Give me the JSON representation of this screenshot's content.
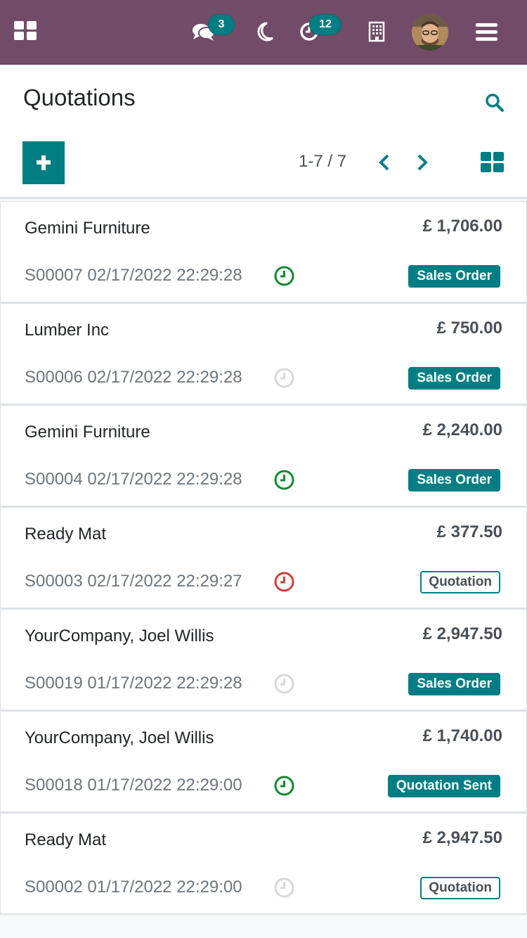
{
  "navbar": {
    "apps_icon": "apps-grid-icon",
    "discuss_icon": "chat-bubbles-icon",
    "messages_count": "3",
    "theme_icon": "moon-icon",
    "activity_icon": "clock-icon",
    "activities_count": "12",
    "company_icon": "building-icon",
    "menu_icon": "hamburger-icon",
    "bar_color": "#714b67"
  },
  "control_panel": {
    "title": "Quotations",
    "pager_value": "1-7 / 7",
    "accent_color": "#017e84"
  },
  "records": [
    {
      "customer": "Gemini Furniture",
      "amount": "£ 1,706.00",
      "reference": "S00007 02/17/2022 22:29:28",
      "activity": "planned",
      "state": "Sales Order",
      "state_style": "solid"
    },
    {
      "customer": "Lumber Inc",
      "amount": "£ 750.00",
      "reference": "S00006 02/17/2022 22:29:28",
      "activity": "none",
      "state": "Sales Order",
      "state_style": "solid"
    },
    {
      "customer": "Gemini Furniture",
      "amount": "£ 2,240.00",
      "reference": "S00004 02/17/2022 22:29:28",
      "activity": "planned",
      "state": "Sales Order",
      "state_style": "solid"
    },
    {
      "customer": "Ready Mat",
      "amount": "£ 377.50",
      "reference": "S00003 02/17/2022 22:29:27",
      "activity": "overdue",
      "state": "Quotation",
      "state_style": "outline"
    },
    {
      "customer": "YourCompany, Joel Willis",
      "amount": "£ 2,947.50",
      "reference": "S00019 01/17/2022 22:29:28",
      "activity": "none",
      "state": "Sales Order",
      "state_style": "solid"
    },
    {
      "customer": "YourCompany, Joel Willis",
      "amount": "£ 1,740.00",
      "reference": "S00018 01/17/2022 22:29:00",
      "activity": "planned",
      "state": "Quotation Sent",
      "state_style": "solid"
    },
    {
      "customer": "Ready Mat",
      "amount": "£ 2,947.50",
      "reference": "S00002 01/17/2022 22:29:00",
      "activity": "none",
      "state": "Quotation",
      "state_style": "outline"
    }
  ],
  "activity_colors": {
    "planned": "#128a2d",
    "none": "#d8d8d8",
    "overdue": "#d23f3a"
  }
}
